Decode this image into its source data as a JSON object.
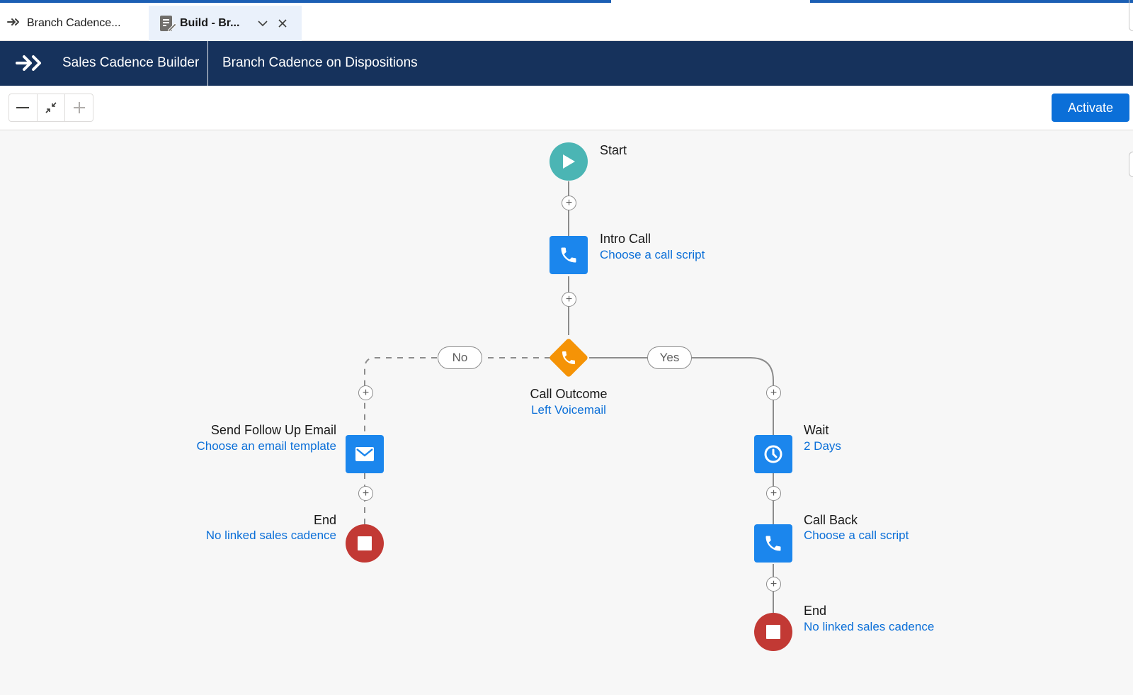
{
  "tabs": [
    {
      "label": "Branch Cadence...",
      "icon": "cadence-arrow-icon"
    },
    {
      "label": "Build - Br...",
      "icon": "build-doc-icon",
      "active": true
    }
  ],
  "header": {
    "app_name": "Sales Cadence Builder",
    "record_name": "Branch Cadence on Dispositions"
  },
  "toolbar": {
    "zoom_out_icon": "minus-icon",
    "fit_icon": "contract-icon",
    "zoom_in_icon": "plus-icon",
    "activate_label": "Activate"
  },
  "flow": {
    "start": {
      "title": "Start"
    },
    "intro_call": {
      "title": "Intro Call",
      "link": "Choose a call script"
    },
    "call_outcome": {
      "title": "Call Outcome",
      "link": "Left Voicemail",
      "branch_no": "No",
      "branch_yes": "Yes"
    },
    "send_email": {
      "title": "Send Follow Up Email",
      "link": "Choose an email template"
    },
    "end_left": {
      "title": "End",
      "link": "No linked sales cadence"
    },
    "wait": {
      "title": "Wait",
      "link": "2 Days"
    },
    "call_back": {
      "title": "Call Back",
      "link": "Choose a call script"
    },
    "end_right": {
      "title": "End",
      "link": "No linked sales cadence"
    }
  },
  "colors": {
    "header_bg": "#16325c",
    "accent_blue": "#1b86ed",
    "link_blue": "#0b6fd8",
    "start_teal": "#4bb5b4",
    "end_red": "#c23934",
    "branch_orange": "#f59306"
  }
}
